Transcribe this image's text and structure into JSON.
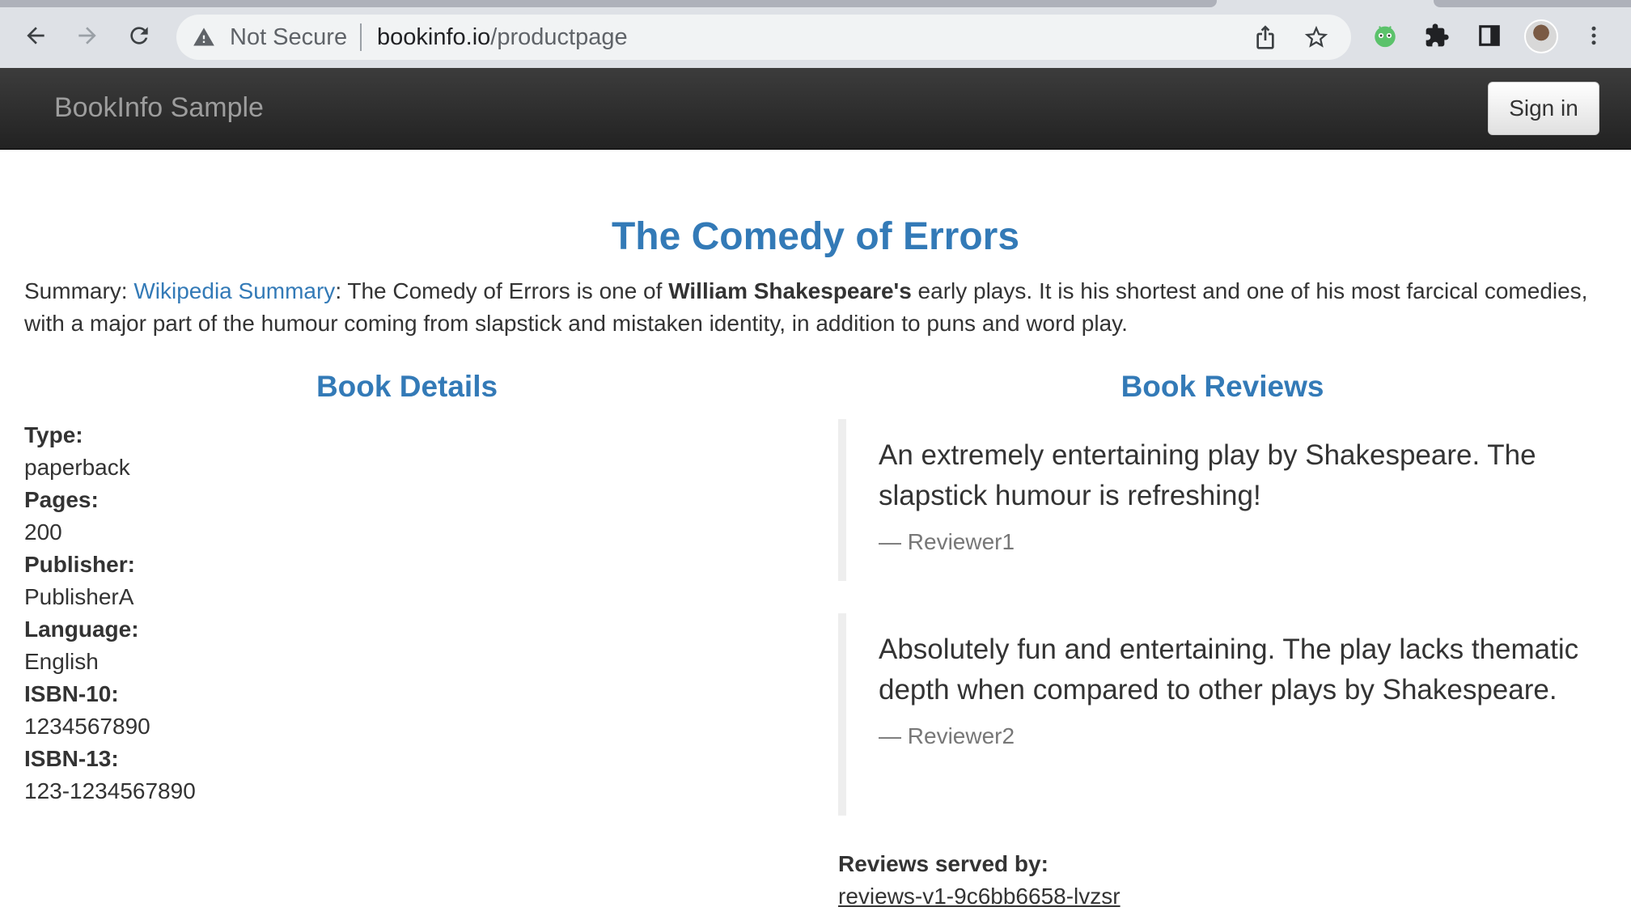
{
  "browser": {
    "not_secure": "Not Secure",
    "url_host": "bookinfo.io",
    "url_path": "/productpage"
  },
  "navbar": {
    "brand": "BookInfo Sample",
    "signin": "Sign in"
  },
  "product": {
    "title": "The Comedy of Errors",
    "summary_label": "Summary: ",
    "summary_link": "Wikipedia Summary",
    "summary_text_1": ": The Comedy of Errors is one of ",
    "summary_bold": "William Shakespeare's",
    "summary_text_2": " early plays. It is his shortest and one of his most farcical comedies, with a major part of the humour coming from slapstick and mistaken identity, in addition to puns and word play."
  },
  "details": {
    "heading": "Book Details",
    "items": [
      {
        "label": "Type:",
        "value": "paperback"
      },
      {
        "label": "Pages:",
        "value": "200"
      },
      {
        "label": "Publisher:",
        "value": "PublisherA"
      },
      {
        "label": "Language:",
        "value": "English"
      },
      {
        "label": "ISBN-10:",
        "value": "1234567890"
      },
      {
        "label": "ISBN-13:",
        "value": "123-1234567890"
      }
    ]
  },
  "reviews": {
    "heading": "Book Reviews",
    "items": [
      {
        "text": "An extremely entertaining play by Shakespeare. The slapstick humour is refreshing!",
        "author": "— Reviewer1"
      },
      {
        "text": "Absolutely fun and entertaining. The play lacks thematic depth when compared to other plays by Shakespeare.",
        "author": "— Reviewer2"
      }
    ],
    "served_label": "Reviews served by:",
    "served_by": "reviews-v1-9c6bb6658-lvzsr"
  }
}
